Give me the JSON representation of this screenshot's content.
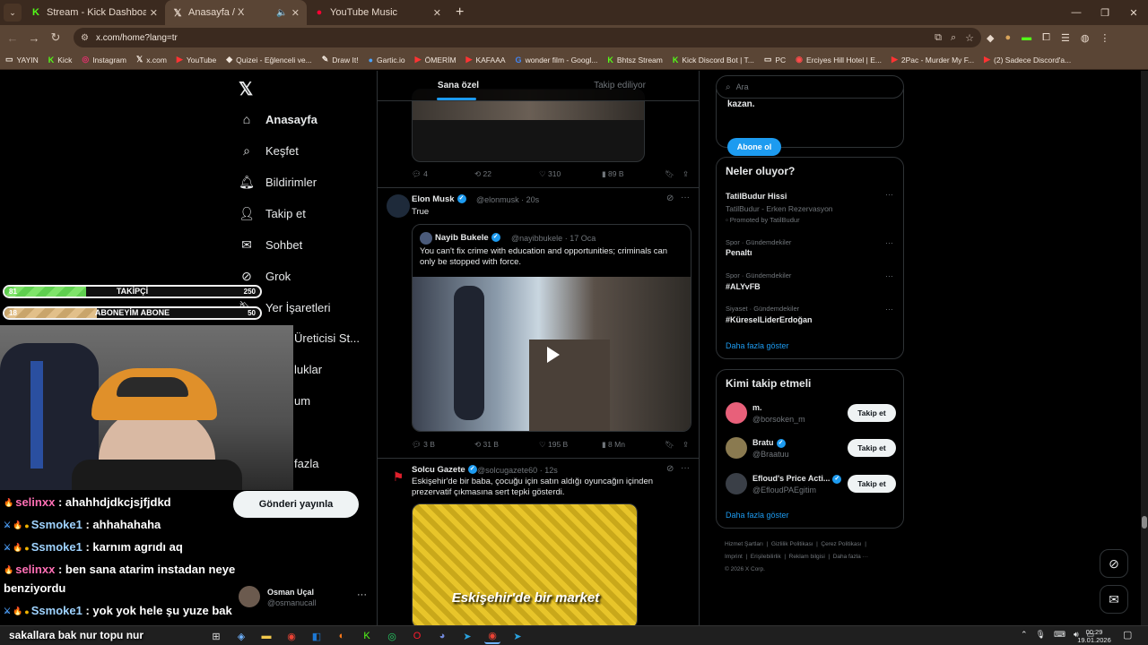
{
  "browser": {
    "tabs": [
      {
        "label": "Stream - Kick Dashboard",
        "icon": "kick-icon",
        "color": "#53fc18"
      },
      {
        "label": "Anasayfa / X",
        "icon": "x-icon",
        "color": "#ffffff"
      },
      {
        "label": "YouTube Music",
        "icon": "youtube-music-icon",
        "color": "#ff0033"
      }
    ],
    "url": "x.com/home?lang=tr",
    "bookmarks": [
      {
        "label": "YAYIN",
        "icon": "folder-icon"
      },
      {
        "label": "Kick",
        "icon": "kick-icon"
      },
      {
        "label": "Instagram",
        "icon": "instagram-icon"
      },
      {
        "label": "x.com",
        "icon": "x-icon"
      },
      {
        "label": "YouTube",
        "icon": "youtube-icon"
      },
      {
        "label": "Quizei - Eğlenceli ve...",
        "icon": "quizei-icon"
      },
      {
        "label": "Draw It!",
        "icon": "drawit-icon"
      },
      {
        "label": "Gartic.io",
        "icon": "gartic-icon"
      },
      {
        "label": "ÖMERİM",
        "icon": "youtube-icon"
      },
      {
        "label": "KAFAAA",
        "icon": "youtube-icon"
      },
      {
        "label": "wonder film - Googl...",
        "icon": "google-icon"
      },
      {
        "label": "Bhtsz Stream",
        "icon": "kick-icon"
      },
      {
        "label": "Kick Discord Bot | T...",
        "icon": "kick-icon"
      },
      {
        "label": "PC",
        "icon": "folder-icon"
      },
      {
        "label": "Erciyes Hill Hotel | E...",
        "icon": "hotel-icon"
      },
      {
        "label": "2Pac - Murder My F...",
        "icon": "youtube-icon"
      },
      {
        "label": "(2) Sadece Discord'a...",
        "icon": "youtube-icon"
      }
    ]
  },
  "nav": {
    "items": [
      {
        "label": "Anasayfa",
        "icon": "home-icon"
      },
      {
        "label": "Keşfet",
        "icon": "search-icon"
      },
      {
        "label": "Bildirimler",
        "icon": "bell-icon"
      },
      {
        "label": "Takip et",
        "icon": "person-add-icon"
      },
      {
        "label": "Sohbet",
        "icon": "mail-icon"
      },
      {
        "label": "Grok",
        "icon": "grok-icon"
      },
      {
        "label": "Yer İşaretleri",
        "icon": "bookmark-icon"
      },
      {
        "label": "Üreticisi St...",
        "icon": "creator-icon"
      },
      {
        "label": "luklar",
        "icon": "community-icon"
      },
      {
        "label": "um",
        "icon": "premium-icon"
      },
      {
        "label": "fazla",
        "icon": "more-icon"
      }
    ],
    "post_button": "Gönderi yayınla",
    "account": {
      "name": "Osman Uçal",
      "handle": "@osmanucall"
    }
  },
  "feed": {
    "tabs": [
      "Sana özel",
      "Takip ediliyor"
    ],
    "top_actions": {
      "replies": "4",
      "reposts": "22",
      "likes": "310",
      "views": "89 B"
    },
    "tweets": [
      {
        "name": "Elon Musk",
        "handle": "@elonmusk",
        "time": "· 20s",
        "text": "True",
        "quote": {
          "name": "Nayib Bukele",
          "handle": "@nayibbukele",
          "time": "· 17 Oca",
          "text": "You can't fix crime with education and opportunities; criminals can only be stopped with force."
        },
        "actions": {
          "replies": "3 B",
          "reposts": "31 B",
          "likes": "195 B",
          "views": "8 Mn"
        }
      },
      {
        "name": "Solcu Gazete",
        "handle": "@solcugazete60",
        "time": "· 12s",
        "text": "Eskişehir'de bir baba, çocuğu için satın aldığı oyuncağın içinden prezervatif çıkmasına sert tepki gösterdi.",
        "media_caption": "Eskişehir'de bir market"
      }
    ]
  },
  "sidebar": {
    "search_placeholder": "Ara",
    "premium": {
      "text": "kazan.",
      "button": "Abone ol"
    },
    "trends": {
      "title": "Neler oluyor?",
      "items": [
        {
          "category": "",
          "name": "TatilBudur Hissi",
          "sub": "TatilBudur - Erken Rezervasyon",
          "promoted": "Promoted by TatilBudur"
        },
        {
          "category": "Spor · Gündemdekiler",
          "name": "Penaltı",
          "sub": "",
          "promoted": ""
        },
        {
          "category": "Spor · Gündemdekiler",
          "name": "#ALYvFB",
          "sub": "",
          "promoted": ""
        },
        {
          "category": "Siyaset · Gündemdekiler",
          "name": "#KüreselLiderErdoğan",
          "sub": "",
          "promoted": ""
        }
      ],
      "show_more": "Daha fazla göster"
    },
    "who_to_follow": {
      "title": "Kimi takip etmeli",
      "items": [
        {
          "name": "m.",
          "handle": "@borsoken_m",
          "verified": false,
          "avatar_color": "#e8607a"
        },
        {
          "name": "Bratu",
          "handle": "@Braatuu",
          "verified": true,
          "avatar_color": "#8a7a50"
        },
        {
          "name": "Efloud's Price Acti...",
          "handle": "@EfloudPAEgitim",
          "verified": true,
          "avatar_color": "#3a3f47"
        }
      ],
      "follow_label": "Takip et",
      "show_more": "Daha fazla göster"
    },
    "footer": [
      "Hizmet Şartları",
      "Gizlilik Politikası",
      "Çerez Politikası",
      "Imprint",
      "Erişilebilirlik",
      "Reklam bilgisi",
      "Daha fazla ···",
      "© 2026 X Corp."
    ]
  },
  "overlay": {
    "follower_goal": {
      "current": "81",
      "label": "TAKİPÇİ",
      "goal": "250",
      "progress": 0.32
    },
    "sub_goal": {
      "current": "18",
      "label": "ABONEYİM ABONE",
      "goal": "50",
      "progress": 0.36
    },
    "chat": [
      {
        "user": "selinxx",
        "message": ": ahahhdjdkcjsjfjdkd",
        "badges": [
          "flame"
        ]
      },
      {
        "user": "Ssmoke1",
        "message": ": ahhahahaha",
        "badges": [
          "mod",
          "flame",
          "warn"
        ]
      },
      {
        "user": "Ssmoke1",
        "message": ": karnım agrıdı aq",
        "badges": [
          "mod",
          "flame",
          "warn"
        ]
      },
      {
        "user": "selinxx",
        "message": ": ben sana atarim instadan neye",
        "badges": [
          "flame"
        ]
      },
      {
        "user": "",
        "message": "benziyordu",
        "badges": []
      },
      {
        "user": "Ssmoke1",
        "message": ": yok yok hele şu yuze bak",
        "badges": [
          "mod",
          "flame",
          "warn"
        ]
      },
      {
        "user": "",
        "message": "sakallara bak nur topu nur",
        "badges": []
      }
    ]
  },
  "taskbar": {
    "time": "00:29",
    "date": "19.01.2026"
  }
}
